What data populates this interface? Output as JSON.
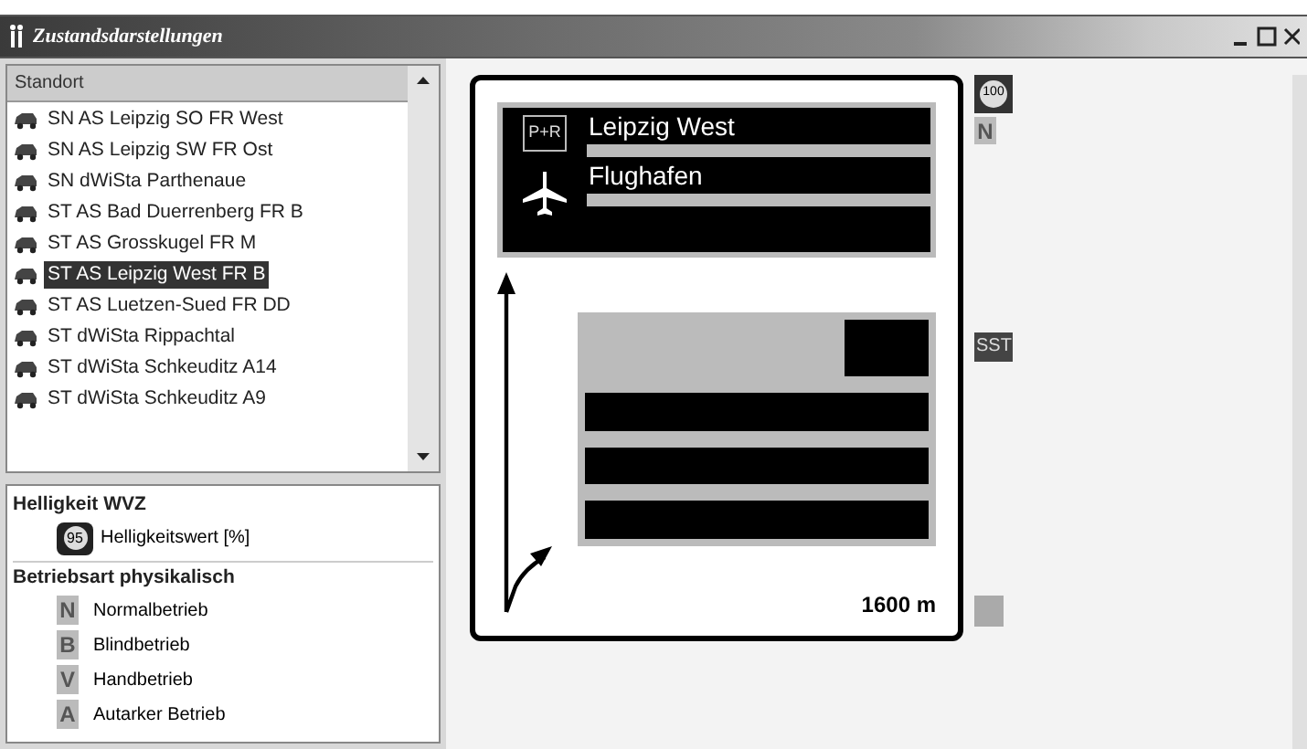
{
  "window": {
    "title": "Zustandsdarstellungen"
  },
  "location_list": {
    "header": "Standort",
    "items": [
      {
        "label": "SN AS Leipzig SO FR West",
        "selected": false
      },
      {
        "label": "SN AS Leipzig SW FR Ost",
        "selected": false
      },
      {
        "label": "SN dWiSta Parthenaue",
        "selected": false
      },
      {
        "label": "ST AS Bad Duerrenberg FR B",
        "selected": false
      },
      {
        "label": "ST AS Grosskugel FR M",
        "selected": false
      },
      {
        "label": "ST AS Leipzig West FR B",
        "selected": true
      },
      {
        "label": "ST AS Luetzen-Sued FR DD",
        "selected": false
      },
      {
        "label": "ST dWiSta Rippachtal",
        "selected": false
      },
      {
        "label": "ST dWiSta Schkeuditz A14",
        "selected": false
      },
      {
        "label": "ST dWiSta Schkeuditz A9",
        "selected": false
      }
    ]
  },
  "legend": {
    "sections": [
      {
        "title": "Helligkeit WVZ",
        "entries": [
          {
            "kind": "bulb",
            "symbol": "95",
            "label": "Helligkeitswert [%]"
          }
        ]
      },
      {
        "title": "Betriebsart physikalisch",
        "entries": [
          {
            "kind": "letter",
            "symbol": "N",
            "label": "Normalbetrieb"
          },
          {
            "kind": "letter",
            "symbol": "B",
            "label": "Blindbetrieb"
          },
          {
            "kind": "letter",
            "symbol": "V",
            "label": "Handbetrieb"
          },
          {
            "kind": "letter",
            "symbol": "A",
            "label": "Autarker Betrieb"
          }
        ]
      }
    ]
  },
  "sign": {
    "pr_symbol": "P+R",
    "destinations": [
      "Leipzig West",
      "Flughafen"
    ],
    "distance": "1600 m"
  },
  "status_column": {
    "brightness": "100",
    "mode": "N",
    "tag": "SST"
  }
}
